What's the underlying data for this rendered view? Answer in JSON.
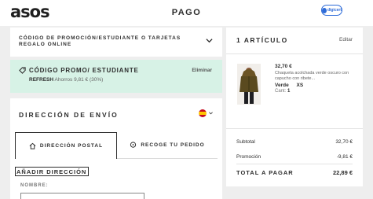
{
  "header": {
    "logo": "asos",
    "title": "PAGO",
    "trust_badge": "digicert"
  },
  "promo_section": {
    "title": "CÓDIGO DE PROMOCIÓN/ESTUDIANTE O TARJETAS REGALO ONLINE"
  },
  "applied_promo": {
    "label": "CÓDIGO PROMO/ ESTUDIANTE",
    "remove_label": "Eliminar",
    "code": "REFRESH",
    "savings": "Ahorros 9,81 € (30%)"
  },
  "shipping": {
    "title": "DIRECCIÓN DE ENVÍO",
    "tabs": [
      {
        "label": "DIRECCIÓN POSTAL",
        "icon": "house-icon",
        "active": true
      },
      {
        "label": "RECOGE TU PEDIDO",
        "icon": "location-pin-icon",
        "active": false
      }
    ],
    "add_address_label": "AÑADIR DIRECCIÓN",
    "name_label": "NOMBRE:",
    "name_value": ""
  },
  "summary": {
    "title": "1 ARTÍCULO",
    "edit_label": "Editar",
    "item": {
      "price": "32,70 €",
      "description": "Chaqueta acolchada verde oscuro con capucho con ribete...",
      "color": "Verde",
      "size": "XS",
      "qty_label": "Cant:",
      "qty": "1"
    },
    "subtotal_label": "Subtotal",
    "subtotal_value": "32,70 €",
    "promo_label": "Promoción",
    "promo_value": "-9,81 €",
    "total_label": "TOTAL A PAGAR",
    "total_value": "22,89 €"
  },
  "colors": {
    "promo_applied_bg": "#d7f2e6",
    "page_bg": "#eeeeee",
    "trust_blue": "#2d6bd8"
  }
}
